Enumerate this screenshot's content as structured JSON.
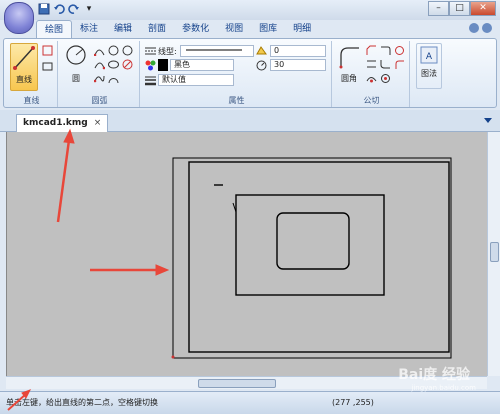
{
  "quick_access": {
    "save_icon": "save-icon",
    "undo_icon": "undo-icon",
    "redo_icon": "redo-icon",
    "customize": "▾"
  },
  "window_controls": {
    "minimize": "–",
    "maximize": "□",
    "close": "✕"
  },
  "ribbon_tabs": [
    "绘图",
    "标注",
    "编辑",
    "剖面",
    "参数化",
    "视图",
    "图库",
    "明细"
  ],
  "ribbon": {
    "line_group": {
      "label": "直线",
      "big_button": "直线"
    },
    "arc_group": {
      "label": "圆弧",
      "circle_label": "圆"
    },
    "properties_group": {
      "label": "属性",
      "linetype_label": "线型:",
      "color_value": "黑色",
      "default_value": "默认值",
      "layer_value": "0",
      "width_value": "30"
    },
    "fillet_group": {
      "label": "公切",
      "round_label": "圆角"
    },
    "drawing_group": {
      "label": "",
      "button": "图法"
    }
  },
  "document_tab": {
    "name": "kmcad1.kmg",
    "close": "×"
  },
  "statusbar": {
    "message": "单击左键，给出直线的第二点，空格键切换",
    "coordinates": "(277 ,255)"
  },
  "watermark": {
    "text": "Bai度 经验",
    "sub": "jingyan.baidu.com"
  },
  "colors": {
    "annotation_arrow": "#e8473a",
    "canvas": "#c0c0c0",
    "ribbon_text": "#15428b"
  }
}
